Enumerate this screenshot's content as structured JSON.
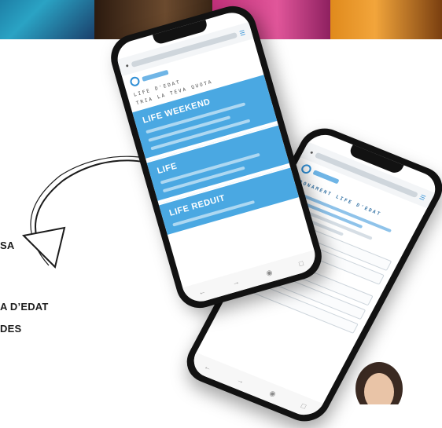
{
  "left_texts": [
    "SA",
    "A D’EDAT",
    "DES"
  ],
  "phone_front": {
    "header": "LIFE D'EDAT",
    "subheader": "TRIA LA TEVA QUOTA",
    "plans": [
      {
        "title": "LIFE WEEKEND"
      },
      {
        "title": "LIFE"
      },
      {
        "title": "LIFE REDUIT"
      }
    ]
  },
  "phone_back": {
    "title": "ABONAMENT LIFE D'EDAT"
  },
  "colors": {
    "plan_blue": "#4aa8e2",
    "accent_blue": "#2f8fd6",
    "text_dark": "#1c1c1c"
  },
  "icons": {
    "arrow": "curved-arrow-icon",
    "lock": "lock-icon",
    "menu": "menu-icon",
    "home": "home-icon"
  }
}
